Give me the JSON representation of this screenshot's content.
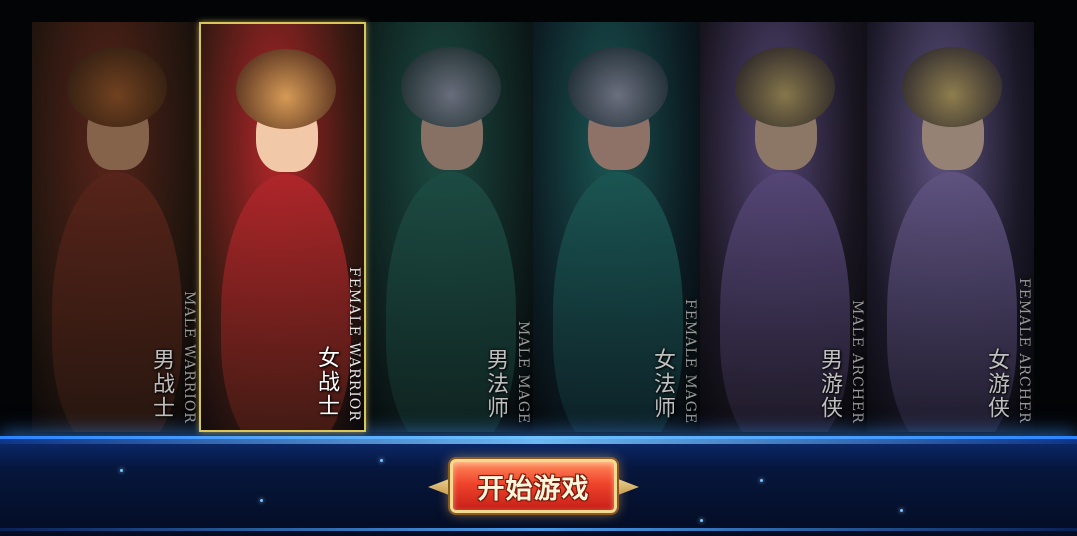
{
  "characters": [
    {
      "name_cn": "男战士",
      "name_en": "MALE WARRIOR",
      "selected": false,
      "colors": {
        "bg": "#3a2418",
        "accent": "#8e3a2a",
        "hair": "#b66a34",
        "skin": "#d7a07a"
      }
    },
    {
      "name_cn": "女战士",
      "name_en": "FEMALE WARRIOR",
      "selected": true,
      "colors": {
        "bg": "#3b1a12",
        "accent": "#b0262a",
        "hair": "#d69a56",
        "skin": "#f1c9a8"
      }
    },
    {
      "name_cn": "男法师",
      "name_en": "MALE MAGE",
      "selected": false,
      "colors": {
        "bg": "#183532",
        "accent": "#2e7a6c",
        "hair": "#a9b2c8",
        "skin": "#d8b6a2"
      }
    },
    {
      "name_cn": "女法师",
      "name_en": "FEMALE MAGE",
      "selected": false,
      "colors": {
        "bg": "#14303a",
        "accent": "#2c8a86",
        "hair": "#aeb4cc",
        "skin": "#e7b9a6"
      }
    },
    {
      "name_cn": "男游侠",
      "name_en": "MALE ARCHER",
      "selected": false,
      "colors": {
        "bg": "#2a2436",
        "accent": "#8a72c0",
        "hair": "#d8c07a",
        "skin": "#e2c1a6"
      }
    },
    {
      "name_cn": "女游侠",
      "name_en": "FEMALE ARCHER",
      "selected": false,
      "colors": {
        "bg": "#2c2840",
        "accent": "#9a86d0",
        "hair": "#e6cb7e",
        "skin": "#f0d2bc"
      }
    }
  ],
  "start_button": {
    "label": "开始游戏"
  }
}
